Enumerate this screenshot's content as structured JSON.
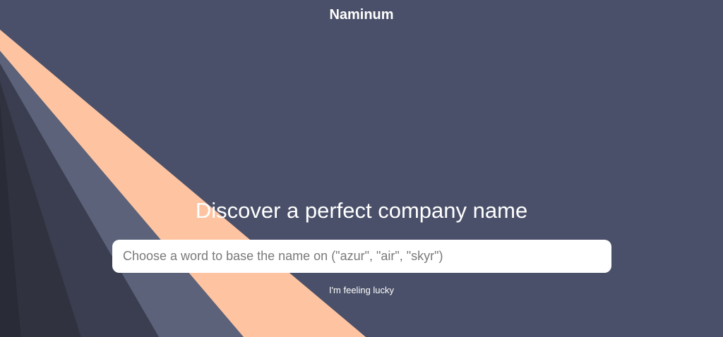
{
  "header": {
    "brand": "Naminum"
  },
  "hero": {
    "title": "Discover a perfect company name"
  },
  "search": {
    "placeholder": "Choose a word to base the name on (\"azur\", \"air\", \"skyr\")",
    "value": ""
  },
  "actions": {
    "lucky_label": "I'm feeling lucky"
  },
  "colors": {
    "background": "#4a5069",
    "stripe_peach": "#fec4a1",
    "stripe_slate": "#5b6279",
    "stripe_dark_1": "#3a3e50",
    "stripe_dark_2": "#30333f",
    "stripe_dark_3": "#292b36",
    "input_background": "#ffffff",
    "text": "#ffffff"
  }
}
